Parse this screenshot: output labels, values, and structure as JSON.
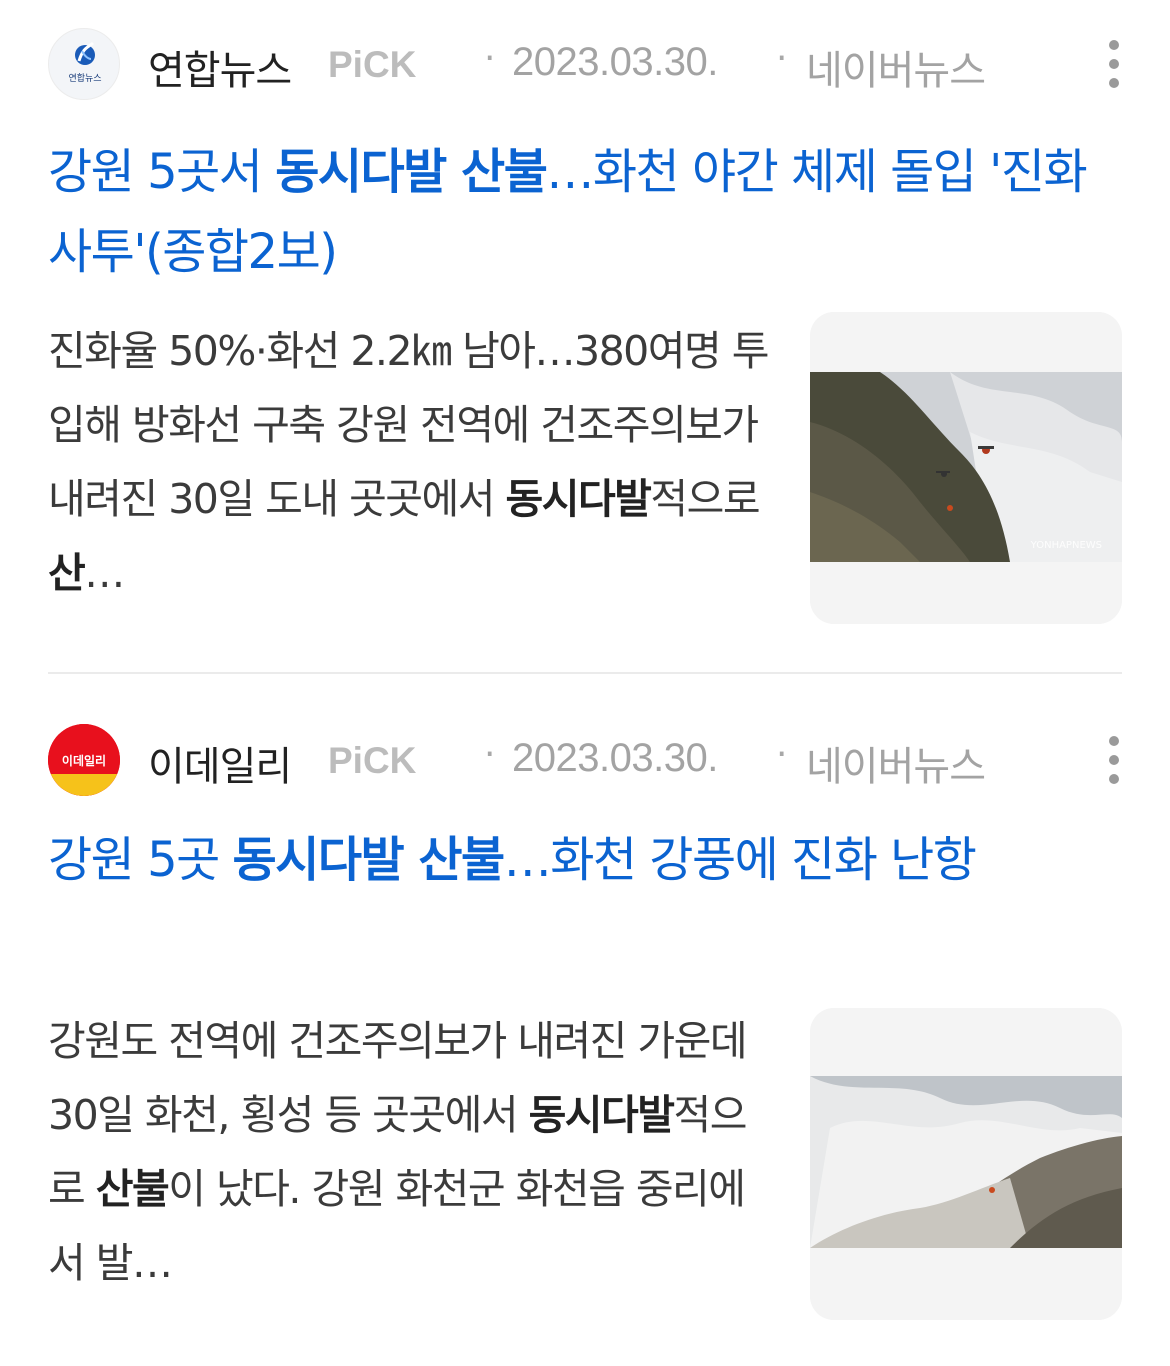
{
  "articles": [
    {
      "press_name": "연합뉴스",
      "press_logo_text": "연합뉴스",
      "pick_label": "PiCK",
      "separator": "·",
      "date": "2023.03.30.",
      "source": "네이버뉴스",
      "title_parts": [
        "강원 5곳서 ",
        "동시다발 산불",
        "…화천 야간 체제 돌입 '진화 사투'(종합2보)"
      ],
      "summary_parts": [
        "진화율 50%·화선 2.2㎞ 남아…380여명 투입해 방화선 구축 강원 전역에 건조주의보가 내려진 30일 도내 곳곳에서 ",
        "동시다발",
        "적으로 ",
        "산",
        "…"
      ],
      "thumbnail_icon": "wildfire-helicopter-photo",
      "watermark": "YONHAPNEWS"
    },
    {
      "press_name": "이데일리",
      "press_logo_text": "이데일리",
      "pick_label": "PiCK",
      "separator": "·",
      "date": "2023.03.30.",
      "source": "네이버뉴스",
      "title_parts": [
        "강원 5곳 ",
        "동시다발 산불",
        "…화천 강풍에 진화 난항"
      ],
      "summary_parts": [
        "강원도 전역에 건조주의보가 내려진 가운데 30일 화천, 횡성 등 곳곳에서 ",
        "동시다발",
        "적으로 ",
        "산불",
        "이 났다. 강원 화천군 화천읍 중리에서 발…"
      ],
      "thumbnail_icon": "wildfire-smoke-photo"
    }
  ],
  "colors": {
    "title": "#0b63d1",
    "meta": "#a3a3a3",
    "pick": "#bcbcbc",
    "summary": "#3b3b3b",
    "edaily_red": "#e8101d"
  }
}
